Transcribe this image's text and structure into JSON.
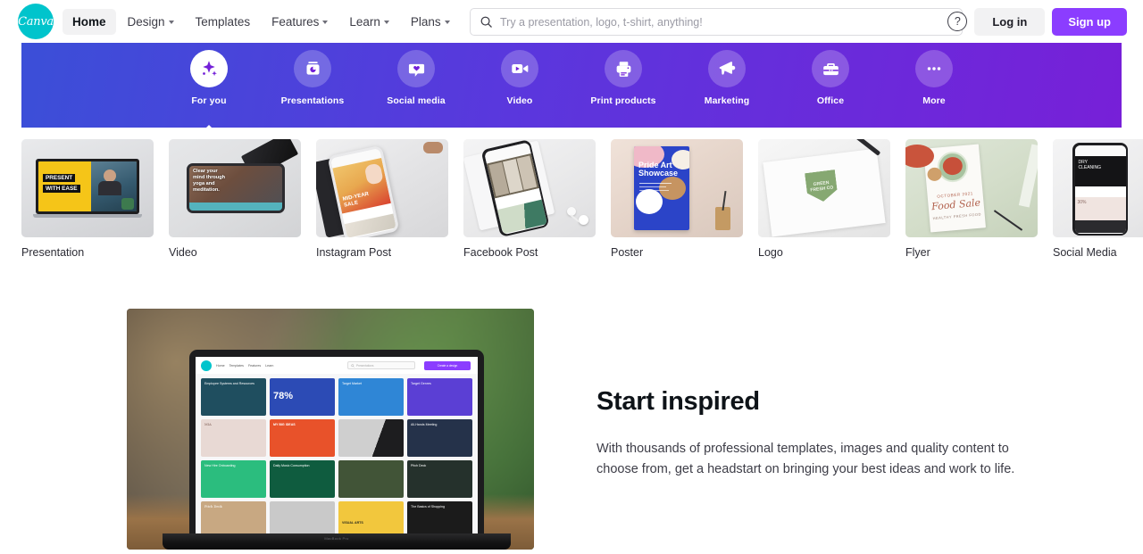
{
  "header": {
    "logo_name": "Canva",
    "nav": [
      {
        "label": "Home",
        "has_chevron": false,
        "active": true
      },
      {
        "label": "Design",
        "has_chevron": true,
        "active": false
      },
      {
        "label": "Templates",
        "has_chevron": false,
        "active": false
      },
      {
        "label": "Features",
        "has_chevron": true,
        "active": false
      },
      {
        "label": "Learn",
        "has_chevron": true,
        "active": false
      },
      {
        "label": "Plans",
        "has_chevron": true,
        "active": false
      }
    ],
    "search": {
      "placeholder": "Try a presentation, logo, t-shirt, anything!",
      "value": "",
      "icon": "search-icon"
    },
    "help_icon": "question-mark-icon",
    "help_label": "?",
    "login_label": "Log in",
    "signup_label": "Sign up"
  },
  "category_bar": {
    "gradient_from": "#3b4fd8",
    "gradient_to": "#7720d8",
    "items": [
      {
        "label": "For you",
        "icon": "sparkle-icon",
        "active": true
      },
      {
        "label": "Presentations",
        "icon": "projector-icon",
        "active": false
      },
      {
        "label": "Social media",
        "icon": "heart-chat-icon",
        "active": false
      },
      {
        "label": "Video",
        "icon": "video-camera-icon",
        "active": false
      },
      {
        "label": "Print products",
        "icon": "printer-icon",
        "active": false
      },
      {
        "label": "Marketing",
        "icon": "megaphone-icon",
        "active": false
      },
      {
        "label": "Office",
        "icon": "briefcase-icon",
        "active": false
      },
      {
        "label": "More",
        "icon": "ellipsis-icon",
        "active": false
      }
    ]
  },
  "thumbnail_strip": {
    "next_icon": "chevron-right-icon",
    "items": [
      {
        "label": "Presentation",
        "art_text": "PRESENT WITH EASE"
      },
      {
        "label": "Video",
        "art_text": "Clear your mind through yoga and meditation."
      },
      {
        "label": "Instagram Post",
        "art_text": "MID-YEAR SALE"
      },
      {
        "label": "Facebook Post",
        "art_text": ""
      },
      {
        "label": "Poster",
        "art_text": "Pride Art Showcase"
      },
      {
        "label": "Logo",
        "art_text": "GREEN FRESH CO"
      },
      {
        "label": "Flyer",
        "art_text": "Food Sale"
      },
      {
        "label": "Social Media",
        "art_text": ""
      }
    ]
  },
  "hero": {
    "title": "Start inspired",
    "body": "With thousands of professional templates, images and quality content to choose from, get a headstart on bringing your best ideas and work to life.",
    "screen": {
      "logo_name": "Canva",
      "nav": [
        "Home",
        "Templates",
        "Features",
        "Learn"
      ],
      "search_placeholder": "Presentations",
      "cta_label": "Create a design",
      "cards": [
        {
          "text": "Employee Systems and Resources",
          "color": "#1f4e5f"
        },
        {
          "text": "78%",
          "color": "#2c4bb5"
        },
        {
          "text": "Target Market",
          "color": "#2f86d6"
        },
        {
          "text": "Target Genres",
          "color": "#5b3fd4"
        },
        {
          "text": "MIA",
          "color": "#e8d9d4"
        },
        {
          "text": "MY BIG IDEAS",
          "color": "#e8522a"
        },
        {
          "text": "",
          "color": "#4a4a4a"
        },
        {
          "text": "All-Hands Meeting",
          "color": "#25324a"
        },
        {
          "text": "New Hire Onboarding",
          "color": "#2bbd7e"
        },
        {
          "text": "Daily Music Consumption",
          "color": "#0f5c3f"
        },
        {
          "text": "",
          "color": "#3f5434"
        },
        {
          "text": "Pitch Deck",
          "color": "#25312c"
        },
        {
          "text": "Pitch Deck",
          "color": "#c8a882"
        },
        {
          "text": "",
          "color": "#c9c9c9"
        },
        {
          "text": "VISUAL ARTS",
          "color": "#f2c73d"
        },
        {
          "text": "The Basics of Shopping",
          "color": "#1b1b1b"
        }
      ],
      "brand_label": "MacBook Pro"
    }
  }
}
